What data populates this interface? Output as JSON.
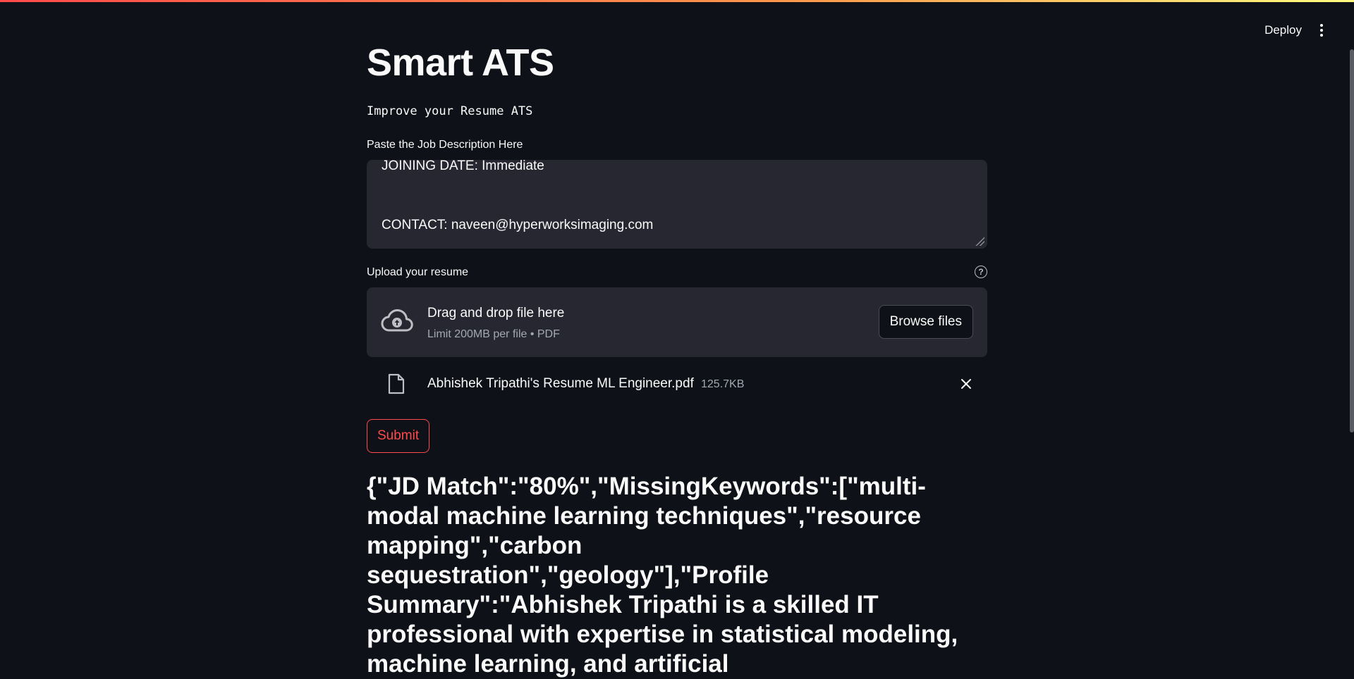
{
  "header": {
    "deploy_label": "Deploy"
  },
  "main": {
    "title": "Smart ATS",
    "subtitle": "Improve your Resume ATS",
    "job_description": {
      "label": "Paste the Job Description Here",
      "visible_lines": [
        "JOINING DATE: Immediate",
        "CONTACT: naveen@hyperworksimaging.com"
      ]
    },
    "uploader": {
      "label": "Upload your resume",
      "help_icon": "?",
      "drop_title": "Drag and drop file here",
      "drop_limit": "Limit 200MB per file • PDF",
      "browse_label": "Browse files",
      "file": {
        "name": "Abhishek Tripathi's Resume ML Engineer.pdf",
        "size": "125.7KB"
      }
    },
    "submit_label": "Submit",
    "result": "{\"JD Match\":\"80%\",\"MissingKeywords\":[\"multi-modal machine learning techniques\",\"resource mapping\",\"carbon sequestration\",\"geology\"],\"Profile Summary\":\"Abhishek Tripathi is a skilled IT professional with expertise in statistical modeling, machine learning, and artificial"
  },
  "colors": {
    "background": "#0e1117",
    "surface": "#262730",
    "accent": "#ff4b4b",
    "muted_text": "#a3a8b4"
  }
}
